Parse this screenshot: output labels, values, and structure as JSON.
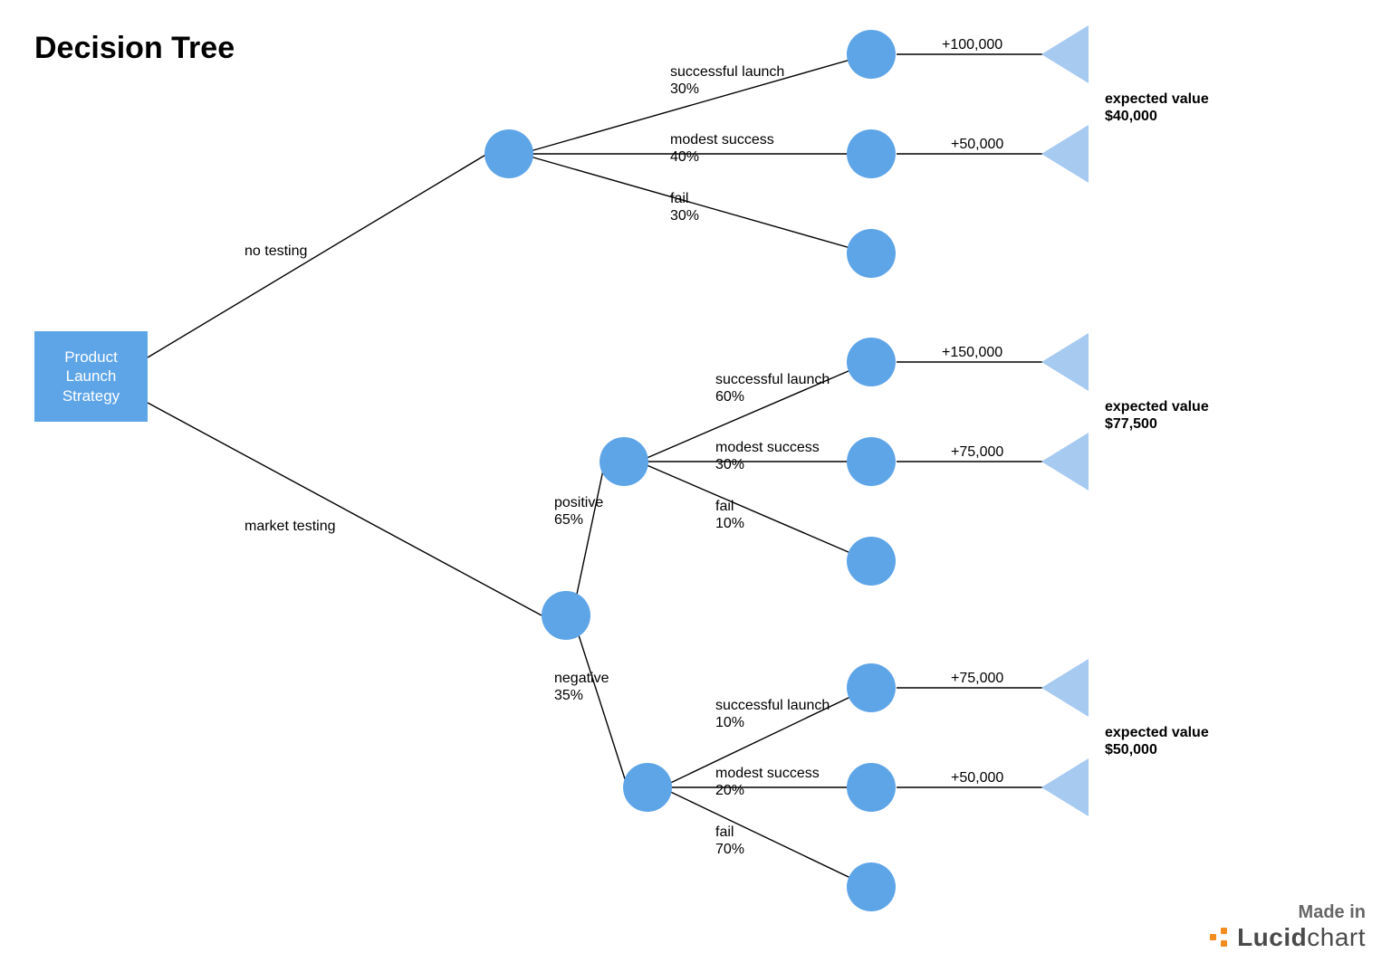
{
  "title": "Decision Tree",
  "root": "Product\nLaunch\nStrategy",
  "branches": {
    "no_testing": "no testing",
    "market_testing": "market testing",
    "positive": "positive\n65%",
    "negative": "negative\n35%"
  },
  "outcomes": {
    "nt_success": "successful launch\n30%",
    "nt_modest": "modest success\n40%",
    "nt_fail": "fail\n30%",
    "pos_success": "successful launch\n60%",
    "pos_modest": "modest success\n30%",
    "pos_fail": "fail\n10%",
    "neg_success": "successful launch\n10%",
    "neg_modest": "modest success\n20%",
    "neg_fail": "fail\n70%"
  },
  "payoffs": {
    "nt_success": "+100,000",
    "nt_modest": "+50,000",
    "pos_success": "+150,000",
    "pos_modest": "+75,000",
    "neg_success": "+75,000",
    "neg_modest": "+50,000"
  },
  "expected": {
    "nt": "expected value\n$40,000",
    "pos": "expected value\n$77,500",
    "neg": "expected value\n$50,000"
  },
  "footer": {
    "made": "Made in",
    "brand_a": "Lucid",
    "brand_b": "chart"
  },
  "chart_data": {
    "type": "tree",
    "title": "Decision Tree",
    "root": "Product Launch Strategy",
    "children": [
      {
        "decision": "no testing",
        "outcomes": [
          {
            "label": "successful launch",
            "probability": 0.3,
            "payoff": 100000
          },
          {
            "label": "modest success",
            "probability": 0.4,
            "payoff": 50000
          },
          {
            "label": "fail",
            "probability": 0.3,
            "payoff": null
          }
        ],
        "expected_value": 40000
      },
      {
        "decision": "market testing",
        "children": [
          {
            "result": "positive",
            "probability": 0.65,
            "outcomes": [
              {
                "label": "successful launch",
                "probability": 0.6,
                "payoff": 150000
              },
              {
                "label": "modest success",
                "probability": 0.3,
                "payoff": 75000
              },
              {
                "label": "fail",
                "probability": 0.1,
                "payoff": null
              }
            ],
            "expected_value": 77500
          },
          {
            "result": "negative",
            "probability": 0.35,
            "outcomes": [
              {
                "label": "successful launch",
                "probability": 0.1,
                "payoff": 75000
              },
              {
                "label": "modest success",
                "probability": 0.2,
                "payoff": 50000
              },
              {
                "label": "fail",
                "probability": 0.7,
                "payoff": null
              }
            ],
            "expected_value": 50000
          }
        ]
      }
    ]
  }
}
